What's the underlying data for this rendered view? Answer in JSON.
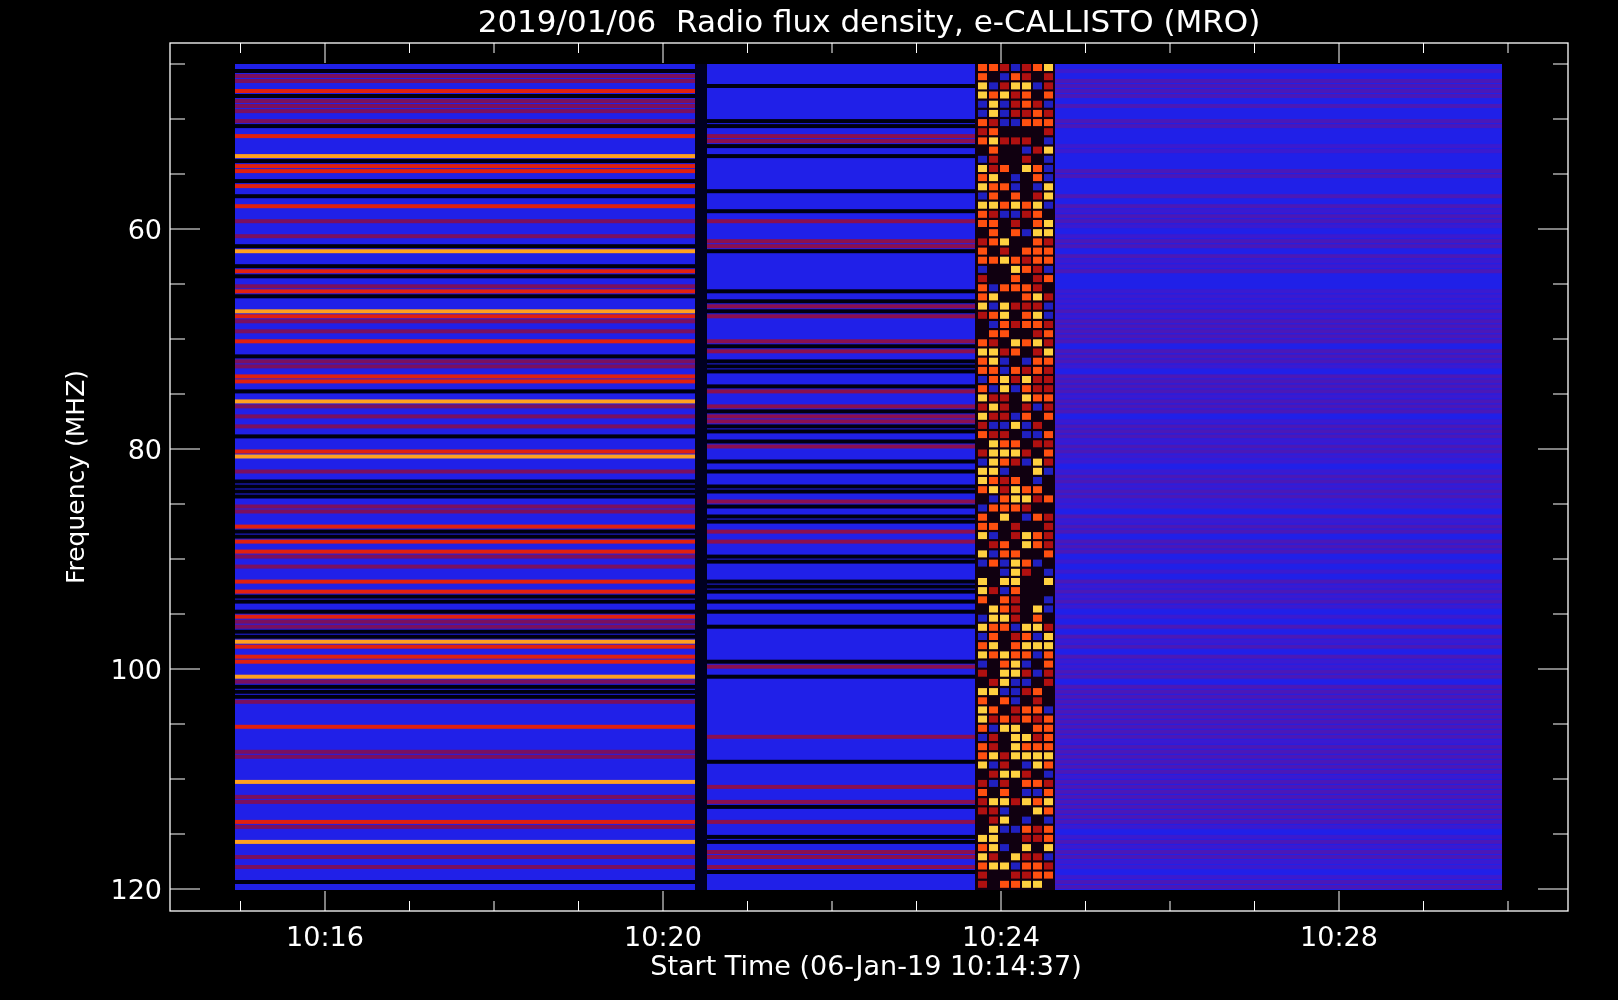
{
  "title": "2019/01/06  Radio flux density, e-CALLISTO (MRO)",
  "y_axis": {
    "label": "Frequency (MHZ)",
    "ticks": [
      "60",
      "80",
      "100",
      "120"
    ]
  },
  "x_axis": {
    "label": "Start Time (06-Jan-19 10:14:37)",
    "ticks": [
      "10:16",
      "10:20",
      "10:24",
      "10:28"
    ]
  }
}
